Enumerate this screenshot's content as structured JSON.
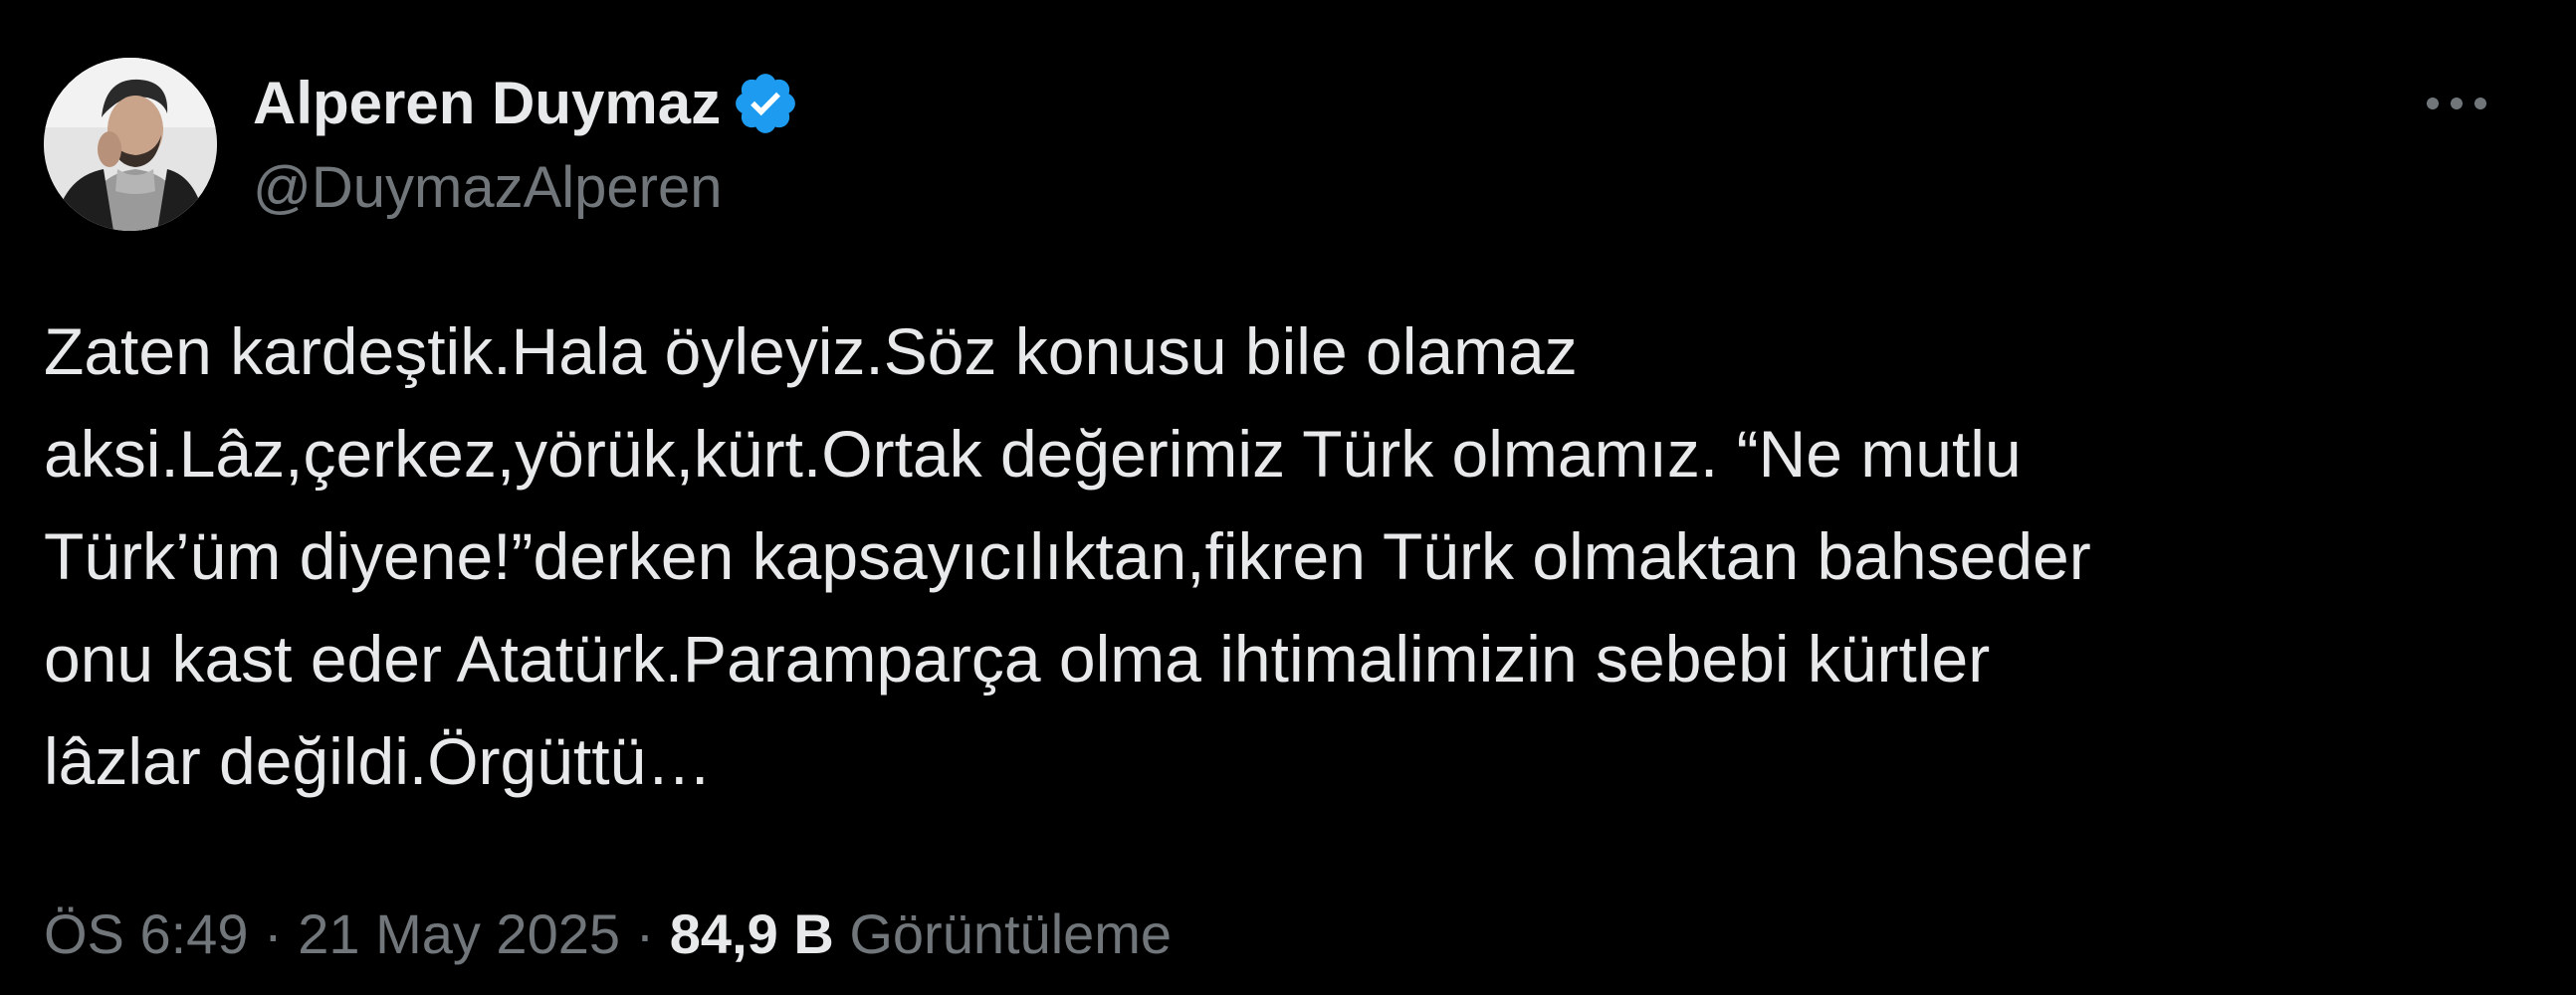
{
  "author": {
    "display_name": "Alperen Duymaz",
    "handle": "@DuymazAlperen",
    "verified_icon": "verified-badge-icon",
    "verified_color": "#1d9bf0"
  },
  "menu": {
    "more_icon": "more-dots-icon"
  },
  "tweet": {
    "text": "Zaten kardeştik.Hala öyleyiz.Söz konusu bile olamaz\naksi.Lâz,çerkez,yörük,kürt.Ortak değerimiz Türk olmamız. “Ne mutlu\nTürk’üm diyene!”derken kapsayıcılıktan,fikren Türk olmaktan bahseder\nonu kast eder Atatürk.Paramparça olma ihtimalimizin sebebi kürtler\nlâzlar değildi.Örgüttü…"
  },
  "meta": {
    "time": "ÖS 6:49",
    "separator": " · ",
    "date": "21 May 2025",
    "views_count": "84,9 B",
    "views_label": "Görüntüleme"
  },
  "colors": {
    "background": "#000000",
    "primary_text": "#e7e9ea",
    "secondary_text": "#71767b"
  }
}
